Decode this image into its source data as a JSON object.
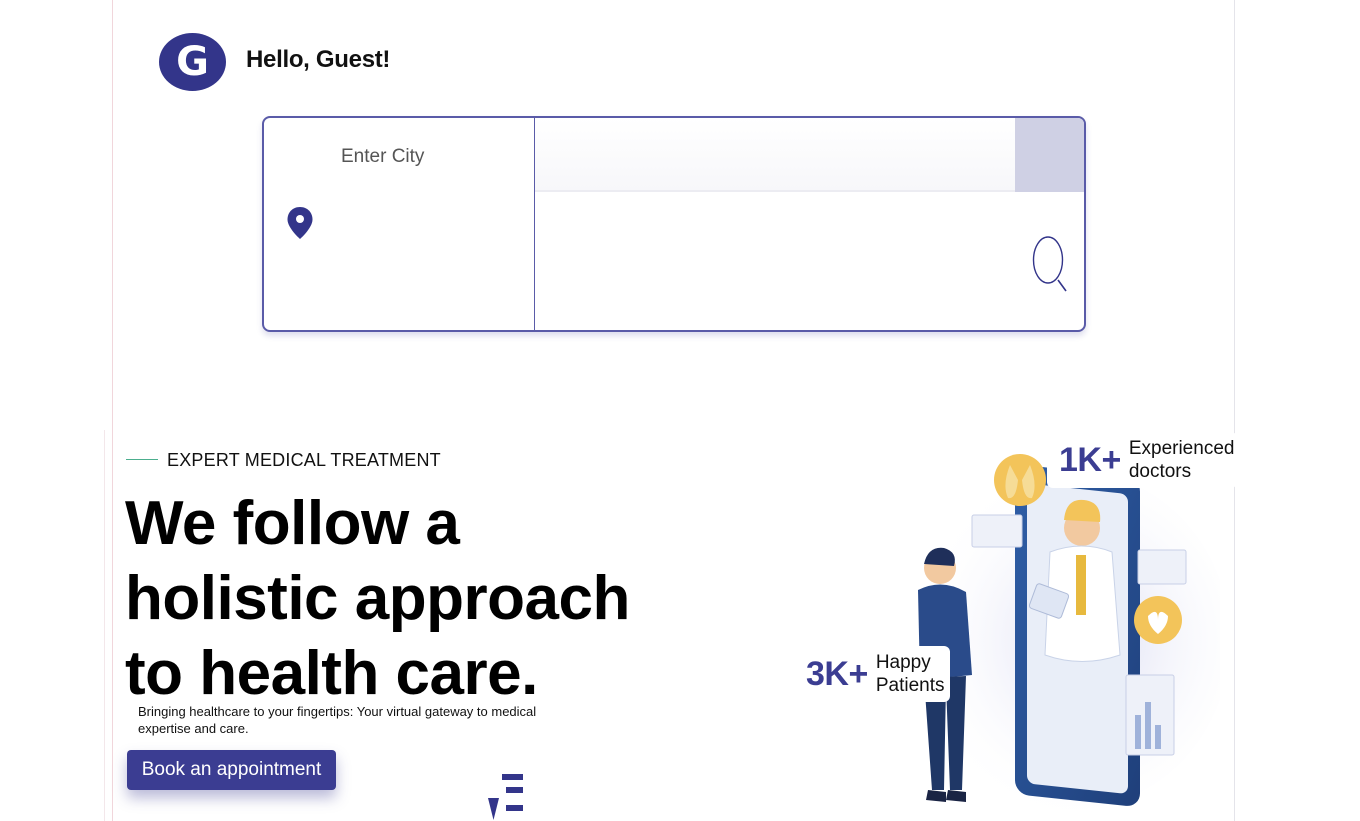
{
  "header": {
    "avatar_initial": "G",
    "greeting": "Hello, Guest!"
  },
  "search": {
    "city_placeholder": "Enter City",
    "query_value": "",
    "location_icon": "map-pin-icon",
    "search_icon": "magnifier-icon"
  },
  "hero": {
    "eyebrow": "EXPERT MEDICAL TREATMENT",
    "headline_line1": "We follow a",
    "headline_line2": "holistic approach",
    "headline_line3": "to health care.",
    "subtitle": "Bringing healthcare to your fingertips: Your virtual gateway to medical expertise and care.",
    "cta_label": "Book an appointment"
  },
  "stats": {
    "doctors": {
      "number": "1K+",
      "label": "Experienced\ndoctors"
    },
    "patients": {
      "number": "3K+",
      "label": "Happy\nPatients"
    }
  },
  "colors": {
    "brand": "#3b3d92",
    "avatar": "#33358a",
    "accent_line": "#4cae8e"
  }
}
